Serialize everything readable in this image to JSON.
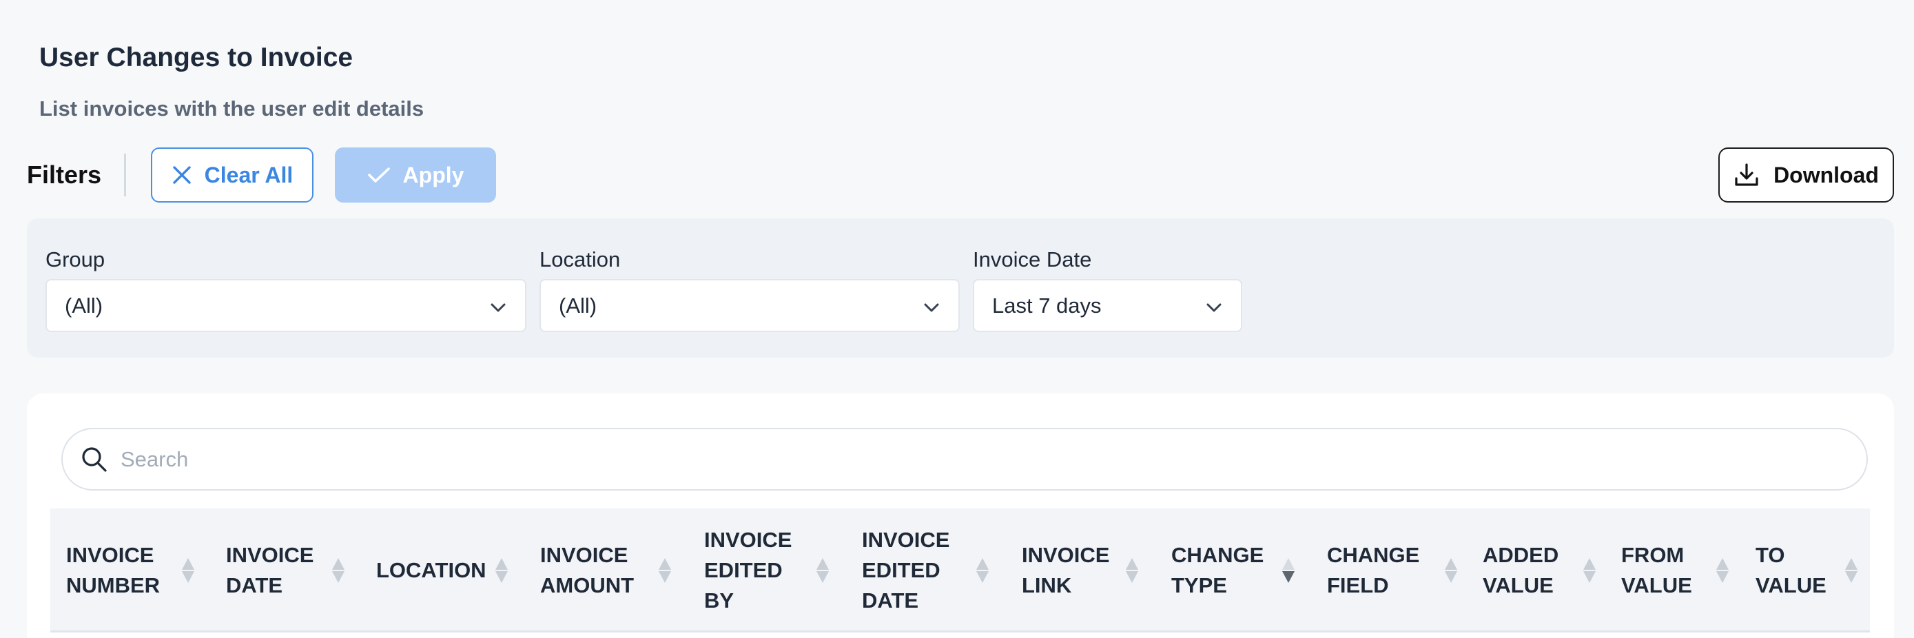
{
  "page": {
    "title": "User Changes to Invoice",
    "subtitle": "List invoices with the user edit details"
  },
  "toolbar": {
    "filters_label": "Filters",
    "clear_label": "Clear All",
    "apply_label": "Apply",
    "download_label": "Download"
  },
  "filters": {
    "group": {
      "label": "Group",
      "value": "(All)"
    },
    "location": {
      "label": "Location",
      "value": "(All)"
    },
    "invoice_date": {
      "label": "Invoice Date",
      "value": "Last 7 days"
    }
  },
  "search": {
    "placeholder": "Search",
    "value": ""
  },
  "table": {
    "columns": [
      {
        "label": "INVOICE\nNUMBER",
        "sort": "none"
      },
      {
        "label": "INVOICE\nDATE",
        "sort": "none"
      },
      {
        "label": "LOCATION",
        "sort": "none"
      },
      {
        "label": "INVOICE\nAMOUNT",
        "sort": "none"
      },
      {
        "label": "INVOICE\nEDITED\nBY",
        "sort": "none"
      },
      {
        "label": "INVOICE\nEDITED\nDATE",
        "sort": "none"
      },
      {
        "label": "INVOICE\nLINK",
        "sort": "none"
      },
      {
        "label": "CHANGE\nTYPE",
        "sort": "descending"
      },
      {
        "label": "CHANGE\nFIELD",
        "sort": "none"
      },
      {
        "label": "ADDED\nVALUE",
        "sort": "none"
      },
      {
        "label": "FROM\nVALUE",
        "sort": "none"
      },
      {
        "label": "TO\nVALUE",
        "sort": "none"
      }
    ]
  },
  "icons": {
    "clear": "close-icon",
    "apply": "check-icon",
    "download": "download-icon",
    "select": "chevron-down-icon",
    "search": "search-icon",
    "sort": "sort-icon"
  },
  "colors": {
    "accent": "#3a86e0",
    "apply_disabled": "#a9cbf6",
    "panel": "#eef1f5",
    "table_header": "#f2f4f7"
  }
}
